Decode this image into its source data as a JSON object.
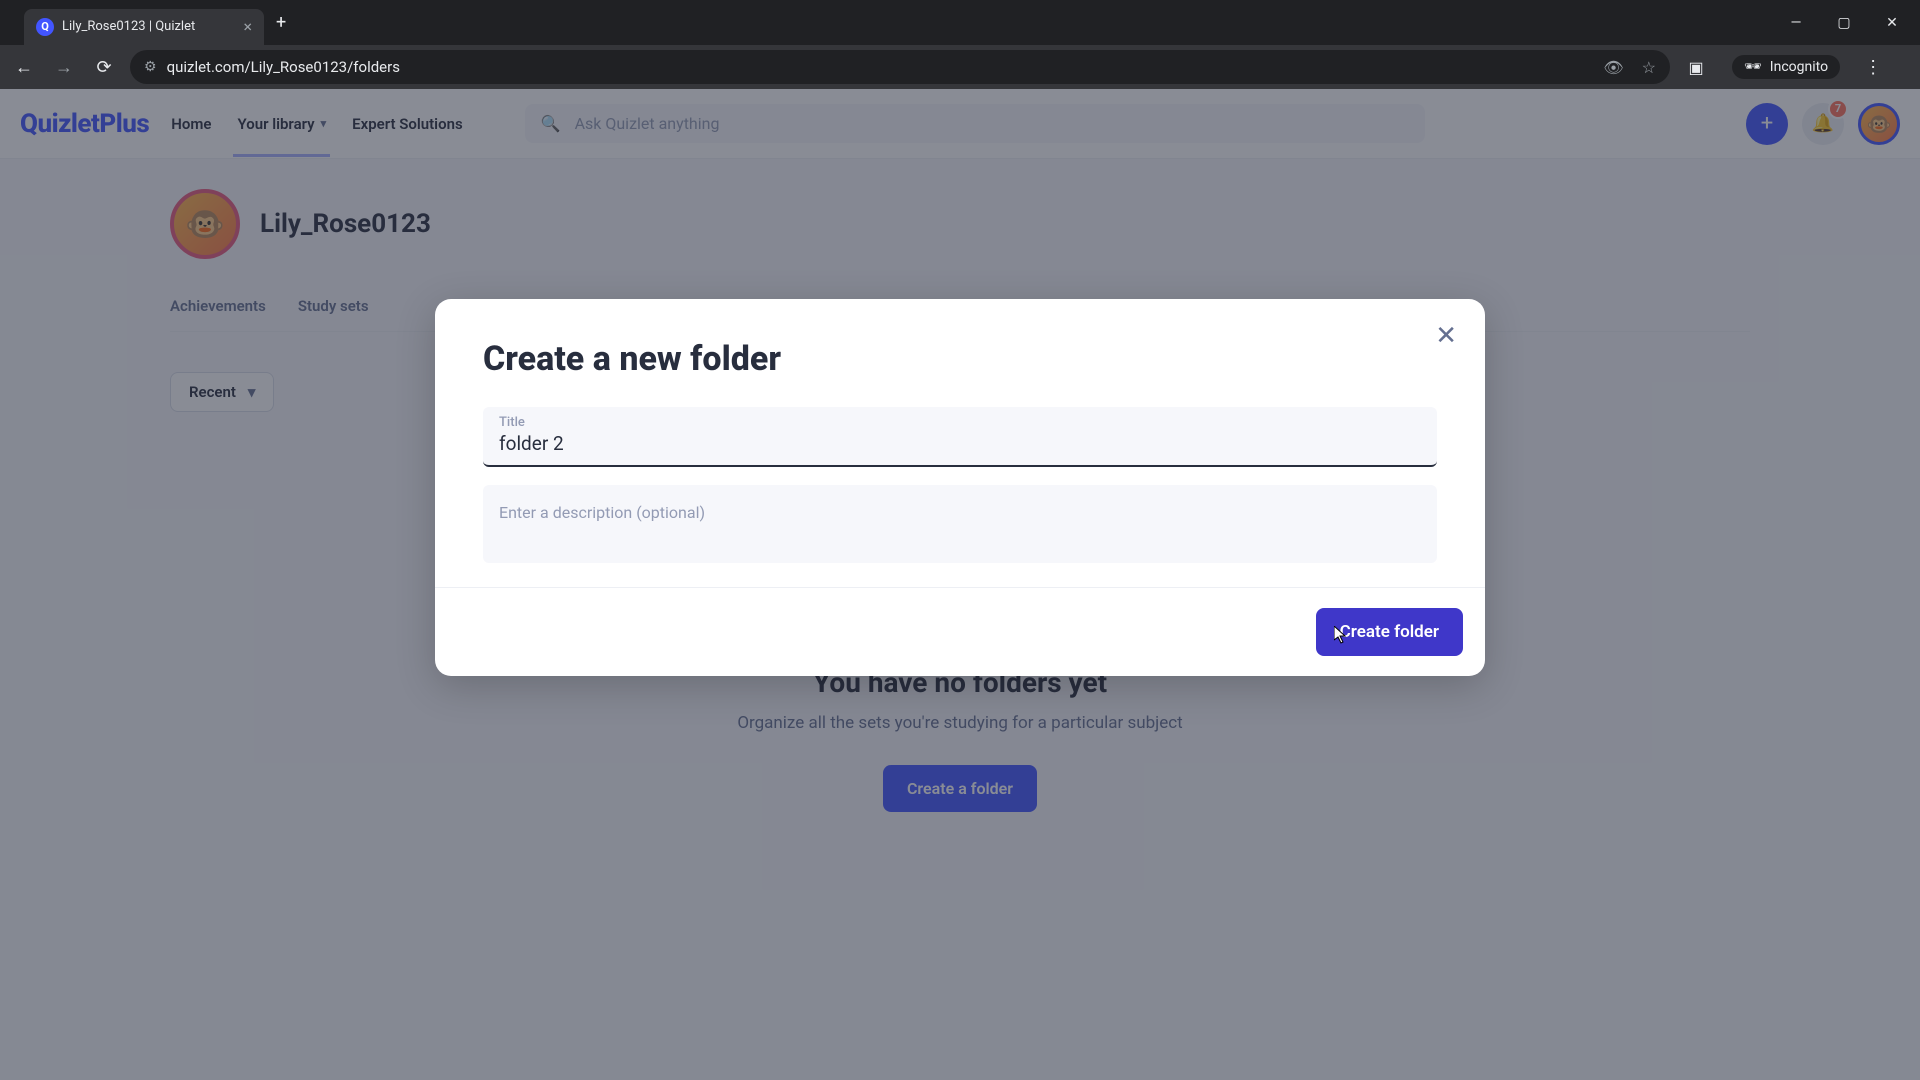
{
  "browser": {
    "tab_title": "Lily_Rose0123 | Quizlet",
    "url": "quizlet.com/Lily_Rose0123/folders",
    "incognito_label": "Incognito"
  },
  "header": {
    "logo_main": "Quizlet",
    "logo_suffix": "Plus",
    "nav_home": "Home",
    "nav_library": "Your library",
    "nav_expert": "Expert Solutions",
    "search_placeholder": "Ask Quizlet anything",
    "notification_count": "7"
  },
  "profile": {
    "username": "Lily_Rose0123",
    "tabs": {
      "achievements": "Achievements",
      "study_sets": "Study sets"
    },
    "filter_label": "Recent"
  },
  "empty": {
    "title": "You have no folders yet",
    "subtitle": "Organize all the sets you're studying for a particular subject",
    "cta": "Create a folder"
  },
  "modal": {
    "heading": "Create a new folder",
    "title_label": "Title",
    "title_value": "folder 2",
    "description_placeholder": "Enter a description (optional)",
    "submit": "Create folder"
  }
}
